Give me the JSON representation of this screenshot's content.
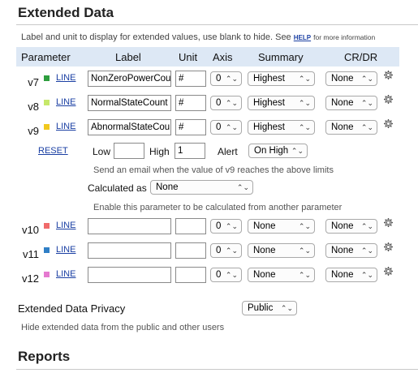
{
  "extended": {
    "title": "Extended Data",
    "description": "Label and unit to display for extended values, use blank to hide. See",
    "help_link": "HELP",
    "help_suffix": "for more information",
    "headers": [
      "Parameter",
      "Label",
      "Unit",
      "Axis",
      "Summary",
      "CR/DR"
    ],
    "rows": [
      {
        "param": "v7",
        "color": "#2e9e3e",
        "line": "LINE",
        "label": "NonZeroPowerCou",
        "unit": "#",
        "axis": "0",
        "summary": "Highest",
        "crdr": "None"
      },
      {
        "param": "v8",
        "color": "#c6e86a",
        "line": "LINE",
        "label": "NormalStateCount",
        "unit": "#",
        "axis": "0",
        "summary": "Highest",
        "crdr": "None"
      },
      {
        "param": "v9",
        "color": "#f1c81e",
        "line": "LINE",
        "label": "AbnormalStateCou",
        "unit": "#",
        "axis": "0",
        "summary": "Highest",
        "crdr": "None"
      },
      {
        "param": "v10",
        "color": "#f06b6b",
        "line": "LINE",
        "label": "",
        "unit": "",
        "axis": "0",
        "summary": "None",
        "crdr": "None"
      },
      {
        "param": "v11",
        "color": "#2f7fc6",
        "line": "LINE",
        "label": "",
        "unit": "",
        "axis": "0",
        "summary": "None",
        "crdr": "None"
      },
      {
        "param": "v12",
        "color": "#e57ad0",
        "line": "LINE",
        "label": "",
        "unit": "",
        "axis": "0",
        "summary": "None",
        "crdr": "None"
      }
    ],
    "alert": {
      "reset": "RESET",
      "low_label": "Low",
      "low_value": "",
      "high_label": "High",
      "high_value": "1",
      "alert_label": "Alert",
      "alert_value": "On High",
      "email_note": "Send an email when the value of v9 reaches the above limits",
      "calculated_label": "Calculated as",
      "calculated_value": "None",
      "calc_note": "Enable this parameter to be calculated from another parameter"
    },
    "privacy": {
      "label": "Extended Data Privacy",
      "value": "Public",
      "note": "Hide extended data from the public and other users"
    }
  },
  "reports": {
    "title": "Reports"
  }
}
